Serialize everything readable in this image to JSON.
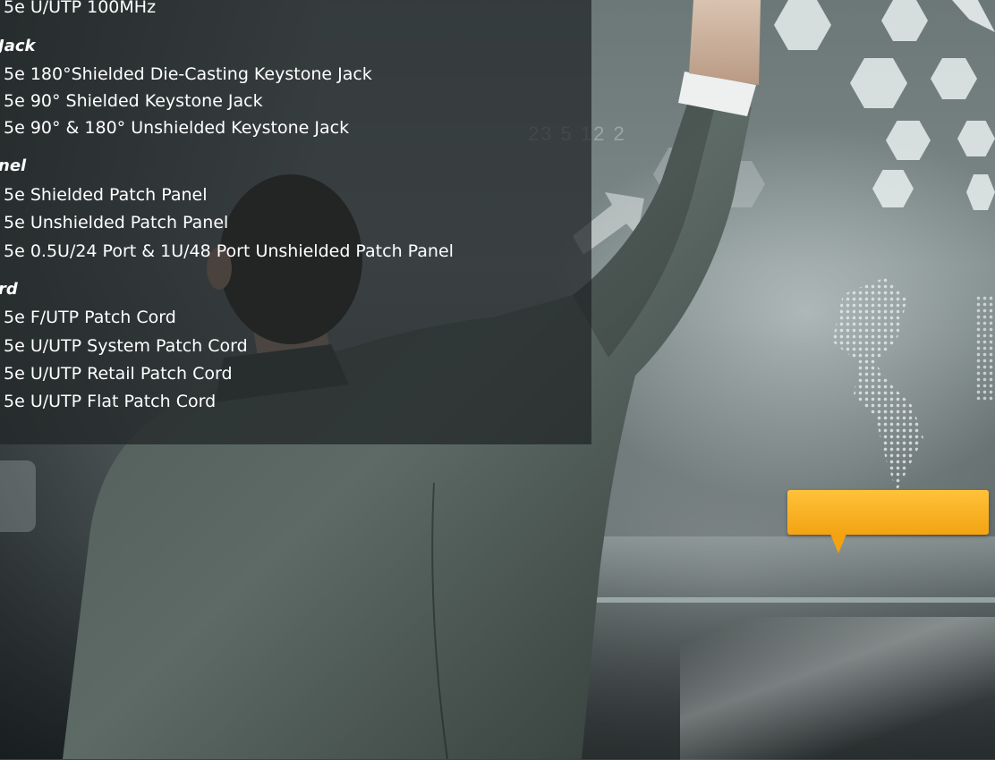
{
  "background": {
    "numbers_text": "23  5   12 2"
  },
  "panel": {
    "lines": [
      {
        "kind": "item",
        "text": "5e U/UTP 100MHz"
      },
      {
        "kind": "heading",
        "text": "Jack"
      },
      {
        "kind": "item",
        "text": "5e 180°Shielded Die-Casting Keystone Jack"
      },
      {
        "kind": "item",
        "text": "5e 90° Shielded Keystone Jack"
      },
      {
        "kind": "item",
        "text": "5e 90° & 180° Unshielded Keystone Jack"
      },
      {
        "kind": "heading",
        "text": "nel"
      },
      {
        "kind": "item",
        "text": "5e Shielded Patch Panel"
      },
      {
        "kind": "item",
        "text": "5e Unshielded Patch Panel"
      },
      {
        "kind": "item",
        "text": "5e 0.5U/24 Port & 1U/48 Port Unshielded Patch Panel"
      },
      {
        "kind": "heading",
        "text": "rd"
      },
      {
        "kind": "item",
        "text": "5e F/UTP Patch Cord"
      },
      {
        "kind": "item",
        "text": "5e U/UTP System Patch Cord"
      },
      {
        "kind": "item",
        "text": "5e U/UTP Retail Patch Cord"
      },
      {
        "kind": "item",
        "text": "5e U/UTP Flat Patch Cord"
      }
    ]
  },
  "colors": {
    "panel_bg": "#202426",
    "text": "#ffffff",
    "callout": "#f3a312"
  }
}
